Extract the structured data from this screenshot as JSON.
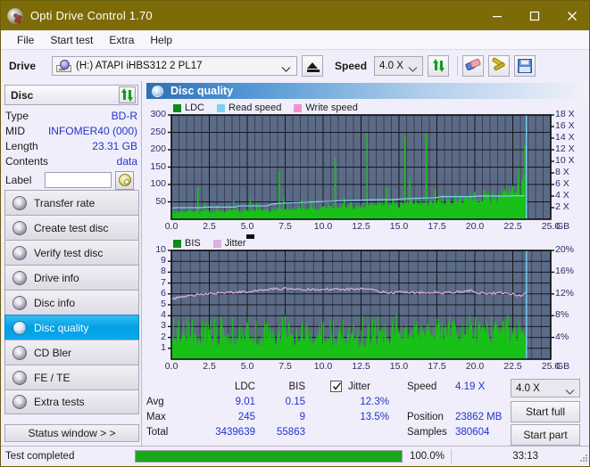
{
  "window": {
    "title": "Opti Drive Control 1.70",
    "icon": "disc-icon",
    "minimize": "minimize-icon",
    "maximize": "maximize-icon",
    "close": "close-icon",
    "titlebar_color": "#7d6b08"
  },
  "menu": {
    "items": [
      {
        "label": "File"
      },
      {
        "label": "Start test"
      },
      {
        "label": "Extra"
      },
      {
        "label": "Help"
      }
    ]
  },
  "toolbar": {
    "drive_label": "Drive",
    "drive_value": "(H:)  ATAPI iHBS312   2 PL17",
    "eject_icon": "eject-icon",
    "speed_label": "Speed",
    "speed_value": "4.0 X",
    "refresh_icon": "refresh-icon",
    "eraser_icon": "eraser-icon",
    "tools_icon": "tools-icon",
    "save_icon": "save-icon"
  },
  "disc_panel": {
    "title": "Disc",
    "refresh_icon": "refresh-icon",
    "rows": [
      {
        "key": "Type",
        "value": "BD-R"
      },
      {
        "key": "MID",
        "value": "INFOMER40 (000)"
      },
      {
        "key": "Length",
        "value": "23.31 GB"
      },
      {
        "key": "Contents",
        "value": "data"
      }
    ],
    "label_key": "Label",
    "label_value": "",
    "label_placeholder": "",
    "label_button_icon": "cd-icon"
  },
  "sidebar": {
    "items": [
      {
        "label": "Transfer rate",
        "icon": "disc-transfer-icon",
        "active": false
      },
      {
        "label": "Create test disc",
        "icon": "disc-create-icon",
        "active": false
      },
      {
        "label": "Verify test disc",
        "icon": "disc-verify-icon",
        "active": false
      },
      {
        "label": "Drive info",
        "icon": "disc-drive-icon",
        "active": false
      },
      {
        "label": "Disc info",
        "icon": "disc-info-icon",
        "active": false
      },
      {
        "label": "Disc quality",
        "icon": "disc-quality-icon",
        "active": true
      },
      {
        "label": "CD Bler",
        "icon": "disc-bler-icon",
        "active": false
      },
      {
        "label": "FE / TE",
        "icon": "disc-fete-icon",
        "active": false
      },
      {
        "label": "Extra tests",
        "icon": "disc-extra-icon",
        "active": false
      }
    ],
    "status_window": "Status window > >"
  },
  "panel": {
    "header": "Disc quality",
    "header_icon": "disc-quality-icon"
  },
  "chart_data": [
    {
      "type": "area",
      "id": "ldc-chart",
      "title": "",
      "xlabel": "GB",
      "ylabel": "",
      "xlim": [
        0.0,
        25.0
      ],
      "xticks": [
        "0.0",
        "2.5",
        "5.0",
        "7.5",
        "10.0",
        "12.5",
        "15.0",
        "17.5",
        "20.0",
        "22.5",
        "25.0"
      ],
      "ylim": [
        0,
        300
      ],
      "yticks": [
        "50",
        "100",
        "150",
        "200",
        "250",
        "300"
      ],
      "y2lim": [
        0,
        18
      ],
      "y2ticks": [
        "2 X",
        "4 X",
        "6 X",
        "8 X",
        "10 X",
        "12 X",
        "14 X",
        "16 X",
        "18 X"
      ],
      "grid": true,
      "legend": [
        {
          "name": "LDC",
          "color": "#0e8a18"
        },
        {
          "name": "Read speed",
          "color": "#79d3f5"
        },
        {
          "name": "Write speed",
          "color": "#f48fd2"
        }
      ],
      "series": [
        {
          "name": "LDC",
          "color": "#18c018",
          "kind": "area",
          "x_end": 23.4,
          "baseline_values": [
            22,
            20,
            24,
            21,
            25,
            23,
            20,
            26,
            22,
            24,
            21,
            23,
            25,
            22,
            20,
            24,
            23,
            26,
            22,
            25,
            23,
            21,
            24,
            22,
            26,
            24,
            23,
            25,
            22,
            24,
            26,
            23,
            25,
            24,
            27,
            25,
            23,
            26,
            24,
            28,
            26,
            25,
            27,
            24,
            26,
            28,
            25,
            27,
            26,
            29,
            27,
            26,
            28,
            30,
            27,
            29,
            28,
            31,
            29,
            28,
            30,
            32,
            29,
            31,
            30,
            33,
            31,
            30,
            32,
            34,
            31,
            33,
            32,
            35,
            33,
            32,
            34,
            36,
            33,
            35,
            34,
            37,
            35,
            34,
            36,
            38,
            35,
            37,
            36,
            39,
            37,
            36,
            38,
            40,
            37,
            39,
            38,
            41,
            39,
            38,
            40,
            42,
            39,
            41,
            40,
            43,
            41,
            40,
            42,
            44,
            41,
            43,
            42,
            45,
            43,
            42,
            44,
            46,
            43,
            45,
            44,
            47,
            45,
            44,
            46,
            48,
            45,
            47,
            46,
            49,
            47,
            46,
            48,
            50,
            52,
            48,
            50,
            49,
            52,
            50,
            54,
            51,
            50,
            53,
            55,
            52,
            54,
            56,
            53,
            55,
            58,
            54,
            56,
            60,
            55,
            58,
            62,
            56,
            60,
            64,
            58,
            62,
            66,
            60,
            64,
            70,
            62,
            68,
            74,
            64,
            72,
            78,
            66,
            76,
            82,
            70,
            80,
            88,
            74,
            86,
            96,
            82,
            94,
            110,
            120
          ],
          "spikes": [
            {
              "x": 1.75,
              "y": 92
            },
            {
              "x": 2.2,
              "y": 46
            },
            {
              "x": 3.0,
              "y": 40
            },
            {
              "x": 4.1,
              "y": 52
            },
            {
              "x": 5.2,
              "y": 60
            },
            {
              "x": 5.6,
              "y": 48
            },
            {
              "x": 7.1,
              "y": 136
            },
            {
              "x": 7.4,
              "y": 62
            },
            {
              "x": 8.6,
              "y": 58
            },
            {
              "x": 9.2,
              "y": 55
            },
            {
              "x": 10.8,
              "y": 176
            },
            {
              "x": 11.4,
              "y": 62
            },
            {
              "x": 12.9,
              "y": 248
            },
            {
              "x": 13.6,
              "y": 50
            },
            {
              "x": 14.2,
              "y": 90
            },
            {
              "x": 14.6,
              "y": 56
            },
            {
              "x": 15.4,
              "y": 238
            },
            {
              "x": 15.7,
              "y": 118
            },
            {
              "x": 16.1,
              "y": 60
            },
            {
              "x": 16.8,
              "y": 246
            },
            {
              "x": 17.4,
              "y": 88
            },
            {
              "x": 17.9,
              "y": 70
            },
            {
              "x": 18.7,
              "y": 72
            },
            {
              "x": 19.3,
              "y": 66
            },
            {
              "x": 20.0,
              "y": 78
            },
            {
              "x": 20.6,
              "y": 84
            },
            {
              "x": 21.2,
              "y": 72
            },
            {
              "x": 21.9,
              "y": 68
            },
            {
              "x": 22.5,
              "y": 96
            },
            {
              "x": 22.9,
              "y": 145
            },
            {
              "x": 23.1,
              "y": 110
            },
            {
              "x": 23.3,
              "y": 212
            }
          ]
        },
        {
          "name": "Read speed",
          "color": "#79d3f5",
          "kind": "line",
          "points": [
            {
              "x": 0.0,
              "y": 1.9
            },
            {
              "x": 0.3,
              "y": 2.0
            },
            {
              "x": 2.0,
              "y": 2.0
            },
            {
              "x": 2.2,
              "y": 2.1
            },
            {
              "x": 4.2,
              "y": 2.1
            },
            {
              "x": 4.4,
              "y": 2.3
            },
            {
              "x": 6.3,
              "y": 2.3
            },
            {
              "x": 6.6,
              "y": 2.6
            },
            {
              "x": 7.4,
              "y": 2.8
            },
            {
              "x": 8.6,
              "y": 2.9
            },
            {
              "x": 9.4,
              "y": 3.0
            },
            {
              "x": 10.4,
              "y": 3.1
            },
            {
              "x": 11.2,
              "y": 3.2
            },
            {
              "x": 12.4,
              "y": 3.3
            },
            {
              "x": 13.0,
              "y": 3.35
            },
            {
              "x": 14.6,
              "y": 3.4
            },
            {
              "x": 15.2,
              "y": 3.5
            },
            {
              "x": 16.0,
              "y": 3.6
            },
            {
              "x": 17.4,
              "y": 3.7
            },
            {
              "x": 17.8,
              "y": 3.9
            },
            {
              "x": 19.8,
              "y": 3.9
            },
            {
              "x": 20.2,
              "y": 4.0
            },
            {
              "x": 22.2,
              "y": 4.0
            },
            {
              "x": 22.6,
              "y": 4.05
            },
            {
              "x": 23.3,
              "y": 4.05
            }
          ]
        },
        {
          "name": "Write speed",
          "color": "#f48fd2",
          "kind": "line",
          "points": []
        },
        {
          "name": "end-marker",
          "color": "#79d3f5",
          "kind": "vline",
          "x": 23.4,
          "y": 18
        }
      ]
    },
    {
      "type": "area",
      "id": "bis-chart",
      "title": "",
      "xlabel": "GB",
      "ylabel": "",
      "xlim": [
        0.0,
        25.0
      ],
      "xticks": [
        "0.0",
        "2.5",
        "5.0",
        "7.5",
        "10.0",
        "12.5",
        "15.0",
        "17.5",
        "20.0",
        "22.5",
        "25.0"
      ],
      "ylim": [
        0,
        10
      ],
      "yticks": [
        "1",
        "2",
        "3",
        "4",
        "5",
        "6",
        "7",
        "8",
        "9",
        "10"
      ],
      "y2lim": [
        0,
        20
      ],
      "y2ticks": [
        "4%",
        "8%",
        "12%",
        "16%",
        "20%"
      ],
      "grid": true,
      "legend": [
        {
          "name": "BIS",
          "color": "#0e8a18"
        },
        {
          "name": "Jitter",
          "color": "#d9b0de"
        }
      ],
      "series": [
        {
          "name": "BIS",
          "color": "#18c018",
          "kind": "area",
          "x_end": 23.4,
          "baseline": 1.9,
          "baseline_late": 2.6,
          "spike_max": 4.1
        },
        {
          "name": "Jitter",
          "color": "#d9b0de",
          "kind": "line",
          "points": [
            {
              "x": 0.0,
              "y": 5.5
            },
            {
              "x": 0.5,
              "y": 5.7
            },
            {
              "x": 1.0,
              "y": 5.8
            },
            {
              "x": 1.5,
              "y": 5.9
            },
            {
              "x": 2.0,
              "y": 6.0
            },
            {
              "x": 2.6,
              "y": 6.05
            },
            {
              "x": 3.2,
              "y": 6.1
            },
            {
              "x": 4.0,
              "y": 6.15
            },
            {
              "x": 5.0,
              "y": 6.2
            },
            {
              "x": 5.8,
              "y": 6.3
            },
            {
              "x": 6.5,
              "y": 6.45
            },
            {
              "x": 7.4,
              "y": 6.5
            },
            {
              "x": 8.2,
              "y": 6.45
            },
            {
              "x": 9.0,
              "y": 6.4
            },
            {
              "x": 10.0,
              "y": 6.45
            },
            {
              "x": 11.0,
              "y": 6.4
            },
            {
              "x": 12.0,
              "y": 6.45
            },
            {
              "x": 12.8,
              "y": 6.5
            },
            {
              "x": 13.4,
              "y": 6.3
            },
            {
              "x": 14.2,
              "y": 6.1
            },
            {
              "x": 15.0,
              "y": 6.15
            },
            {
              "x": 16.0,
              "y": 6.1
            },
            {
              "x": 17.0,
              "y": 6.15
            },
            {
              "x": 18.0,
              "y": 6.1
            },
            {
              "x": 19.0,
              "y": 6.2
            },
            {
              "x": 19.8,
              "y": 6.3
            },
            {
              "x": 20.2,
              "y": 6.1
            },
            {
              "x": 21.0,
              "y": 6.05
            },
            {
              "x": 21.8,
              "y": 6.1
            },
            {
              "x": 22.4,
              "y": 6.05
            },
            {
              "x": 22.9,
              "y": 5.8
            },
            {
              "x": 23.2,
              "y": 5.95
            },
            {
              "x": 23.35,
              "y": 6.1
            }
          ]
        },
        {
          "name": "end-marker",
          "color": "#79d3f5",
          "kind": "vline",
          "x": 23.4,
          "y": 10
        }
      ]
    }
  ],
  "stats": {
    "col_headers": [
      "LDC",
      "BIS"
    ],
    "rows": [
      {
        "label": "Avg",
        "ldc": "9.01",
        "bis": "0.15",
        "jitter": "12.3%"
      },
      {
        "label": "Max",
        "ldc": "245",
        "bis": "9",
        "jitter": "13.5%"
      },
      {
        "label": "Total",
        "ldc": "3439639",
        "bis": "55863",
        "jitter": ""
      }
    ],
    "jitter_label": "Jitter",
    "jitter_checked": true,
    "speed_label": "Speed",
    "speed_value": "4.19 X",
    "position_label": "Position",
    "position_value": "23862 MB",
    "samples_label": "Samples",
    "samples_value": "380604",
    "speed_select": "4.0 X",
    "start_full": "Start full",
    "start_part": "Start part"
  },
  "statusbar": {
    "message": "Test completed",
    "progress_pct": "100.0%",
    "progress_value": 100,
    "elapsed": "33:13"
  }
}
